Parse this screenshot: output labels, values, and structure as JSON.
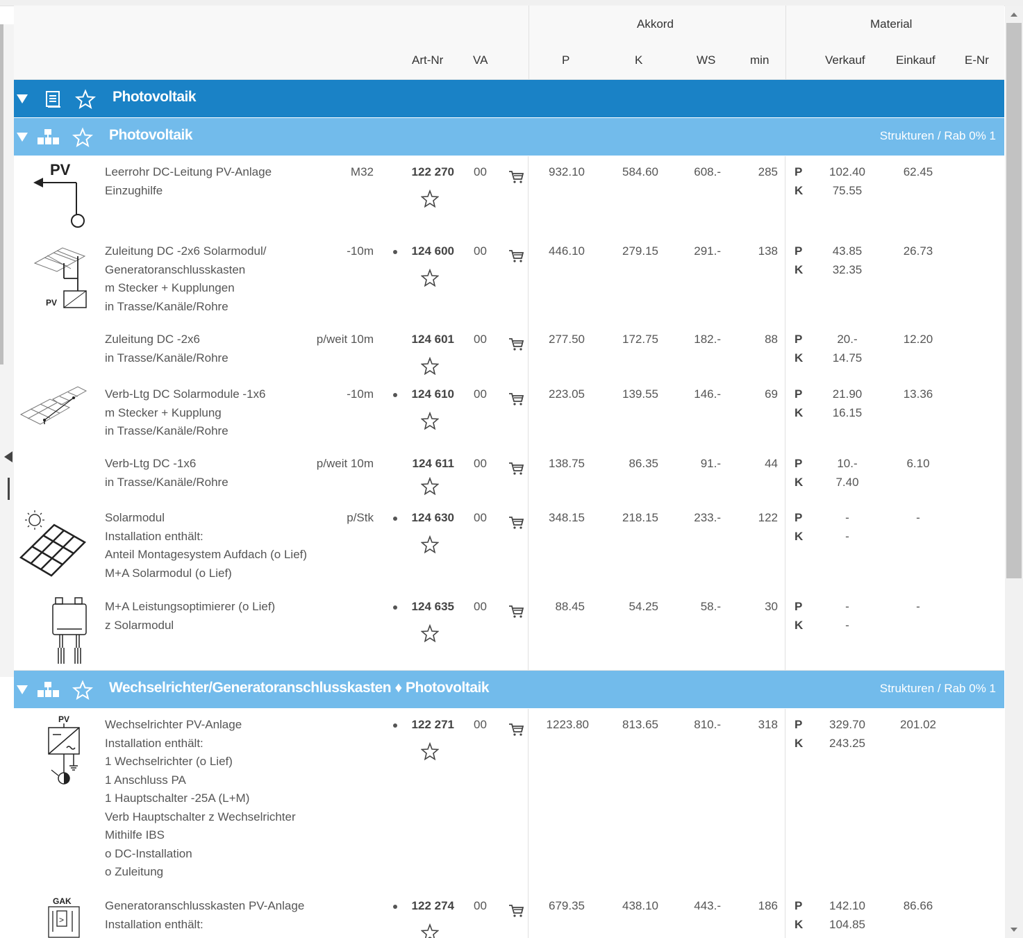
{
  "header": {
    "akkord": "Akkord",
    "material": "Material",
    "art_nr": "Art-Nr",
    "va": "VA",
    "p": "P",
    "k": "K",
    "ws": "WS",
    "min": "min",
    "verkauf": "Verkauf",
    "einkauf": "Einkauf",
    "e_nr": "E-Nr"
  },
  "band1": {
    "title": "Photovoltaik"
  },
  "band2": {
    "title": "Photovoltaik",
    "right": "Strukturen / Rab 0% 1"
  },
  "band3": {
    "title": "Wechselrichter/Generatoranschlusskasten ♦ Photovoltaik",
    "right": "Strukturen / Rab 0% 1"
  },
  "pk": {
    "p": "P",
    "k": "K"
  },
  "rows": [
    {
      "desc": [
        "Leerrohr DC-Leitung PV-Anlage",
        "Einzughilfe"
      ],
      "qual": "M32",
      "art": "122 270",
      "va": "00",
      "p": "932.10",
      "k": "584.60",
      "ws": "608.-",
      "min": "285",
      "verkauf_p": "102.40",
      "verkauf_k": "75.55",
      "einkauf": "62.45",
      "thumb_label": "PV"
    },
    {
      "desc": [
        "Zuleitung DC -2x6 Solarmodul/",
        "Generatoranschlusskasten",
        "m Stecker + Kupplungen",
        "in Trasse/Kanäle/Rohre"
      ],
      "qual": "-10m",
      "art": "124 600",
      "va": "00",
      "p": "446.10",
      "k": "279.15",
      "ws": "291.-",
      "min": "138",
      "verkauf_p": "43.85",
      "verkauf_k": "32.35",
      "einkauf": "26.73",
      "thumb_label": "PV"
    },
    {
      "desc": [
        "Zuleitung DC -2x6",
        "in Trasse/Kanäle/Rohre"
      ],
      "qual": "p/weit 10m",
      "art": "124 601",
      "va": "00",
      "p": "277.50",
      "k": "172.75",
      "ws": "182.-",
      "min": "88",
      "verkauf_p": "20.-",
      "verkauf_k": "14.75",
      "einkauf": "12.20"
    },
    {
      "desc": [
        "Verb-Ltg DC Solarmodule -1x6",
        "m Stecker + Kupplung",
        "in Trasse/Kanäle/Rohre"
      ],
      "qual": "-10m",
      "art": "124 610",
      "va": "00",
      "p": "223.05",
      "k": "139.55",
      "ws": "146.-",
      "min": "69",
      "verkauf_p": "21.90",
      "verkauf_k": "16.15",
      "einkauf": "13.36"
    },
    {
      "desc": [
        "Verb-Ltg DC -1x6",
        "in Trasse/Kanäle/Rohre"
      ],
      "qual": "p/weit 10m",
      "art": "124 611",
      "va": "00",
      "p": "138.75",
      "k": "86.35",
      "ws": "91.-",
      "min": "44",
      "verkauf_p": "10.-",
      "verkauf_k": "7.40",
      "einkauf": "6.10"
    },
    {
      "desc": [
        "Solarmodul",
        "Installation enthält:",
        "Anteil Montagesystem Aufdach (o Lief)",
        "M+A Solarmodul (o Lief)"
      ],
      "qual": "p/Stk",
      "art": "124 630",
      "va": "00",
      "p": "348.15",
      "k": "218.15",
      "ws": "233.-",
      "min": "122",
      "verkauf_p": "-",
      "verkauf_k": "-",
      "einkauf": "-"
    },
    {
      "desc": [
        "M+A Leistungsoptimierer (o Lief)",
        "z Solarmodul"
      ],
      "qual": "",
      "art": "124 635",
      "va": "00",
      "p": "88.45",
      "k": "54.25",
      "ws": "58.-",
      "min": "30",
      "verkauf_p": "-",
      "verkauf_k": "-",
      "einkauf": "-"
    },
    {
      "desc": [
        "Wechselrichter PV-Anlage",
        "Installation enthält:",
        "1 Wechselrichter (o Lief)",
        "1 Anschluss PA",
        "1 Hauptschalter -25A (L+M)",
        "Verb Hauptschalter z Wechselrichter",
        "Mithilfe IBS",
        "o DC-Installation",
        "o Zuleitung"
      ],
      "qual": "",
      "art": "122 271",
      "va": "00",
      "p": "1223.80",
      "k": "813.65",
      "ws": "810.-",
      "min": "318",
      "verkauf_p": "329.70",
      "verkauf_k": "243.25",
      "einkauf": "201.02",
      "thumb_label": "PV"
    },
    {
      "desc": [
        "Generatoranschlusskasten PV-Anlage",
        "Installation enthält:"
      ],
      "qual": "",
      "art": "122 274",
      "va": "00",
      "p": "679.35",
      "k": "438.10",
      "ws": "443.-",
      "min": "186",
      "verkauf_p": "142.10",
      "verkauf_k": "104.85",
      "einkauf": "86.66",
      "thumb_label": "GAK"
    }
  ]
}
